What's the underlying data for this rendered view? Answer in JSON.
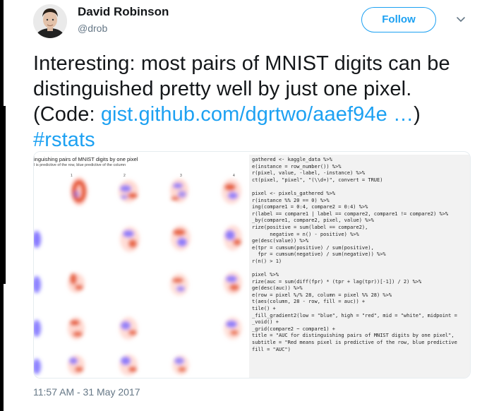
{
  "author": {
    "name": "David Robinson",
    "handle": "@drob",
    "avatar": "avatar-icon"
  },
  "follow_label": "Follow",
  "tweet": {
    "line1": "Interesting: most pairs of MNIST digits can be",
    "line2": "distinguished pretty well by just one pixel.",
    "line3_prefix": "(Code: ",
    "link": "gist.github.com/dgrtwo/aaef94e …",
    "line3_suffix": ")",
    "hashtag": "#rstats"
  },
  "figure": {
    "title": "inguishing pairs of MNIST digits by one pixel",
    "subtitle": "l is predictive of the row, blue predictive of the column",
    "column_numbers": [
      "1",
      "2",
      "3",
      "4"
    ]
  },
  "code_lines": [
    "gathered <- kaggle_data %>%",
    "e(instance = row_number()) %>%",
    "r(pixel, value, -label, -instance) %>%",
    "ct(pixel, \"pixel\", \"(\\\\d+)\", convert = TRUE)",
    "",
    "pixel <- pixels_gathered %>%",
    "r(instance %% 20 == 0) %>%",
    "ing(compare1 = 0:4, compare2 = 0:4) %>%",
    "r(label == compare1 | label == compare2, compare1 != compare2) %>%",
    "_by(compare1, compare2, pixel, value) %>%",
    "rize(positive = sum(label == compare2),",
    "      negative = n() - positive) %>%",
    "ge(desc(value)) %>%",
    "e(tpr = cumsum(positive) / sum(positive),",
    "  fpr = cumsum(negative) / sum(negative)) %>%",
    "r(n() > 1)",
    "",
    "pixel %>%",
    "rize(auc = sum(diff(fpr) * (tpr + lag(tpr))[-1]) / 2) %>%",
    "ge(desc(auc)) %>%",
    "e(row = pixel %/% 28, column = pixel %% 28) %>%",
    "t(aes(column, 28 - row, fill = auc)) +",
    "tile() +",
    "_fill_gradient2(low = \"blue\", high = \"red\", mid = \"white\", midpoint =",
    "_void() +",
    "_grid(compare2 ~ compare1) +",
    "title = \"AUC for distinguishing pairs of MNIST digits by one pixel\",",
    "subtitle = \"Red means pixel is predictive of the row, blue predictive",
    "fill = \"AUC\")"
  ],
  "timestamp": "11:57 AM - 31 May 2017",
  "colors": {
    "accent": "#1da1f2",
    "text": "#14171a",
    "muted": "#657786"
  }
}
